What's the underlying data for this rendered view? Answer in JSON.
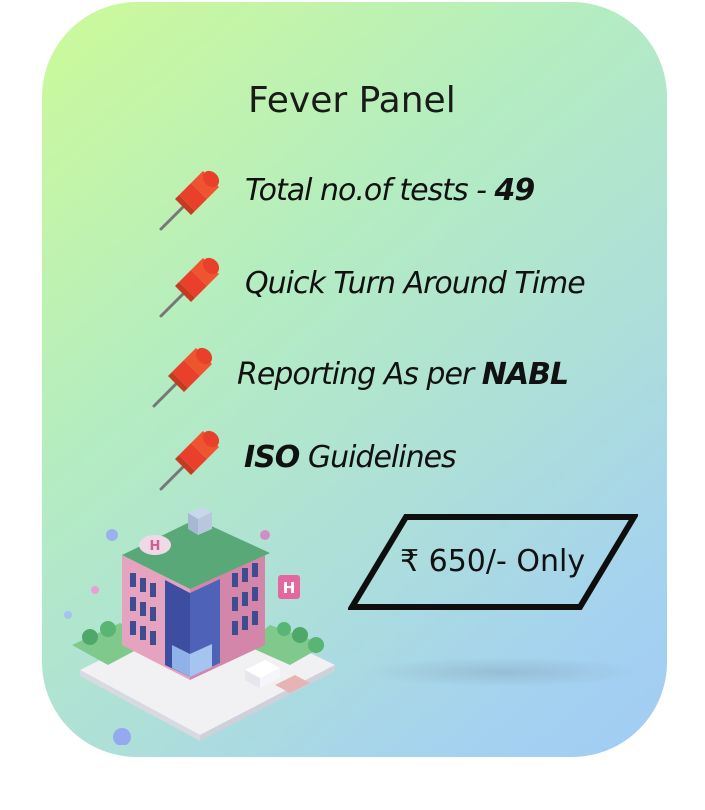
{
  "panel": {
    "title": "Fever Panel"
  },
  "features": [
    {
      "prefix": "Total no.of tests - ",
      "bold": "49",
      "suffix": "",
      "icon": "pushpin-icon"
    },
    {
      "prefix": "Quick Turn Around Time",
      "bold": "",
      "suffix": "",
      "icon": "pushpin-icon"
    },
    {
      "prefix": "Reporting As per ",
      "bold": "NABL",
      "suffix": "",
      "icon": "pushpin-icon"
    },
    {
      "prefix": "",
      "bold": "ISO",
      "suffix": " Guidelines",
      "icon": "pushpin-icon"
    }
  ],
  "price": {
    "label": "₹ 650/- Only"
  },
  "illustration": {
    "sign_letter": "H",
    "icon": "hospital-building-illustration"
  },
  "colors": {
    "card_start": "#cdfa98",
    "card_end": "#a0ccf5",
    "pin": "#e8402a"
  }
}
